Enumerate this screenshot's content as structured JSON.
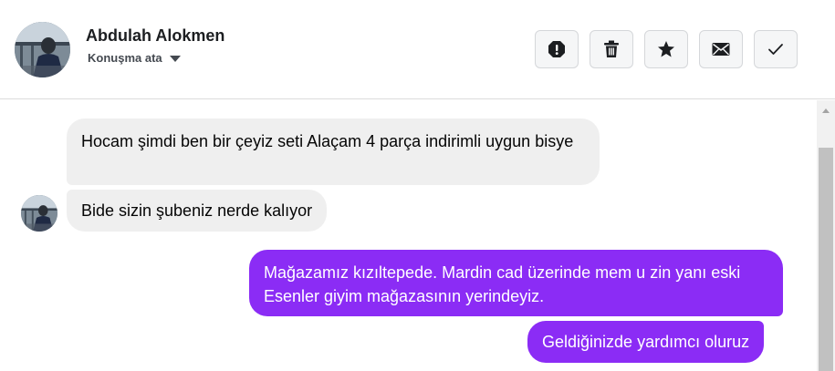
{
  "contact": {
    "name": "Abdulah Alokmen",
    "assign_label": "Konuşma ata"
  },
  "actions": [
    {
      "icon": "alert-icon"
    },
    {
      "icon": "trash-icon"
    },
    {
      "icon": "star-icon"
    },
    {
      "icon": "envelope-icon"
    },
    {
      "icon": "check-icon"
    }
  ],
  "messages": [
    {
      "direction": "incoming",
      "text": "Hocam şimdi ben bir çeyiz seti Alaçam 4 parça indirimli uygun bisye"
    },
    {
      "direction": "incoming",
      "text": "Bide sizin şubeniz nerde kalıyor"
    },
    {
      "direction": "outgoing",
      "text": "Mağazamız kızıltepede. Mardin cad üzerinde mem u zin yanı eski Esenler giyim mağazasının yerindeyiz."
    },
    {
      "direction": "outgoing",
      "text": "Geldiğinizde yardımcı oluruz"
    }
  ],
  "colors": {
    "outgoing_bubble": "#8b2cf5",
    "incoming_bubble": "#efefef",
    "header_border": "#dcdcdc"
  }
}
